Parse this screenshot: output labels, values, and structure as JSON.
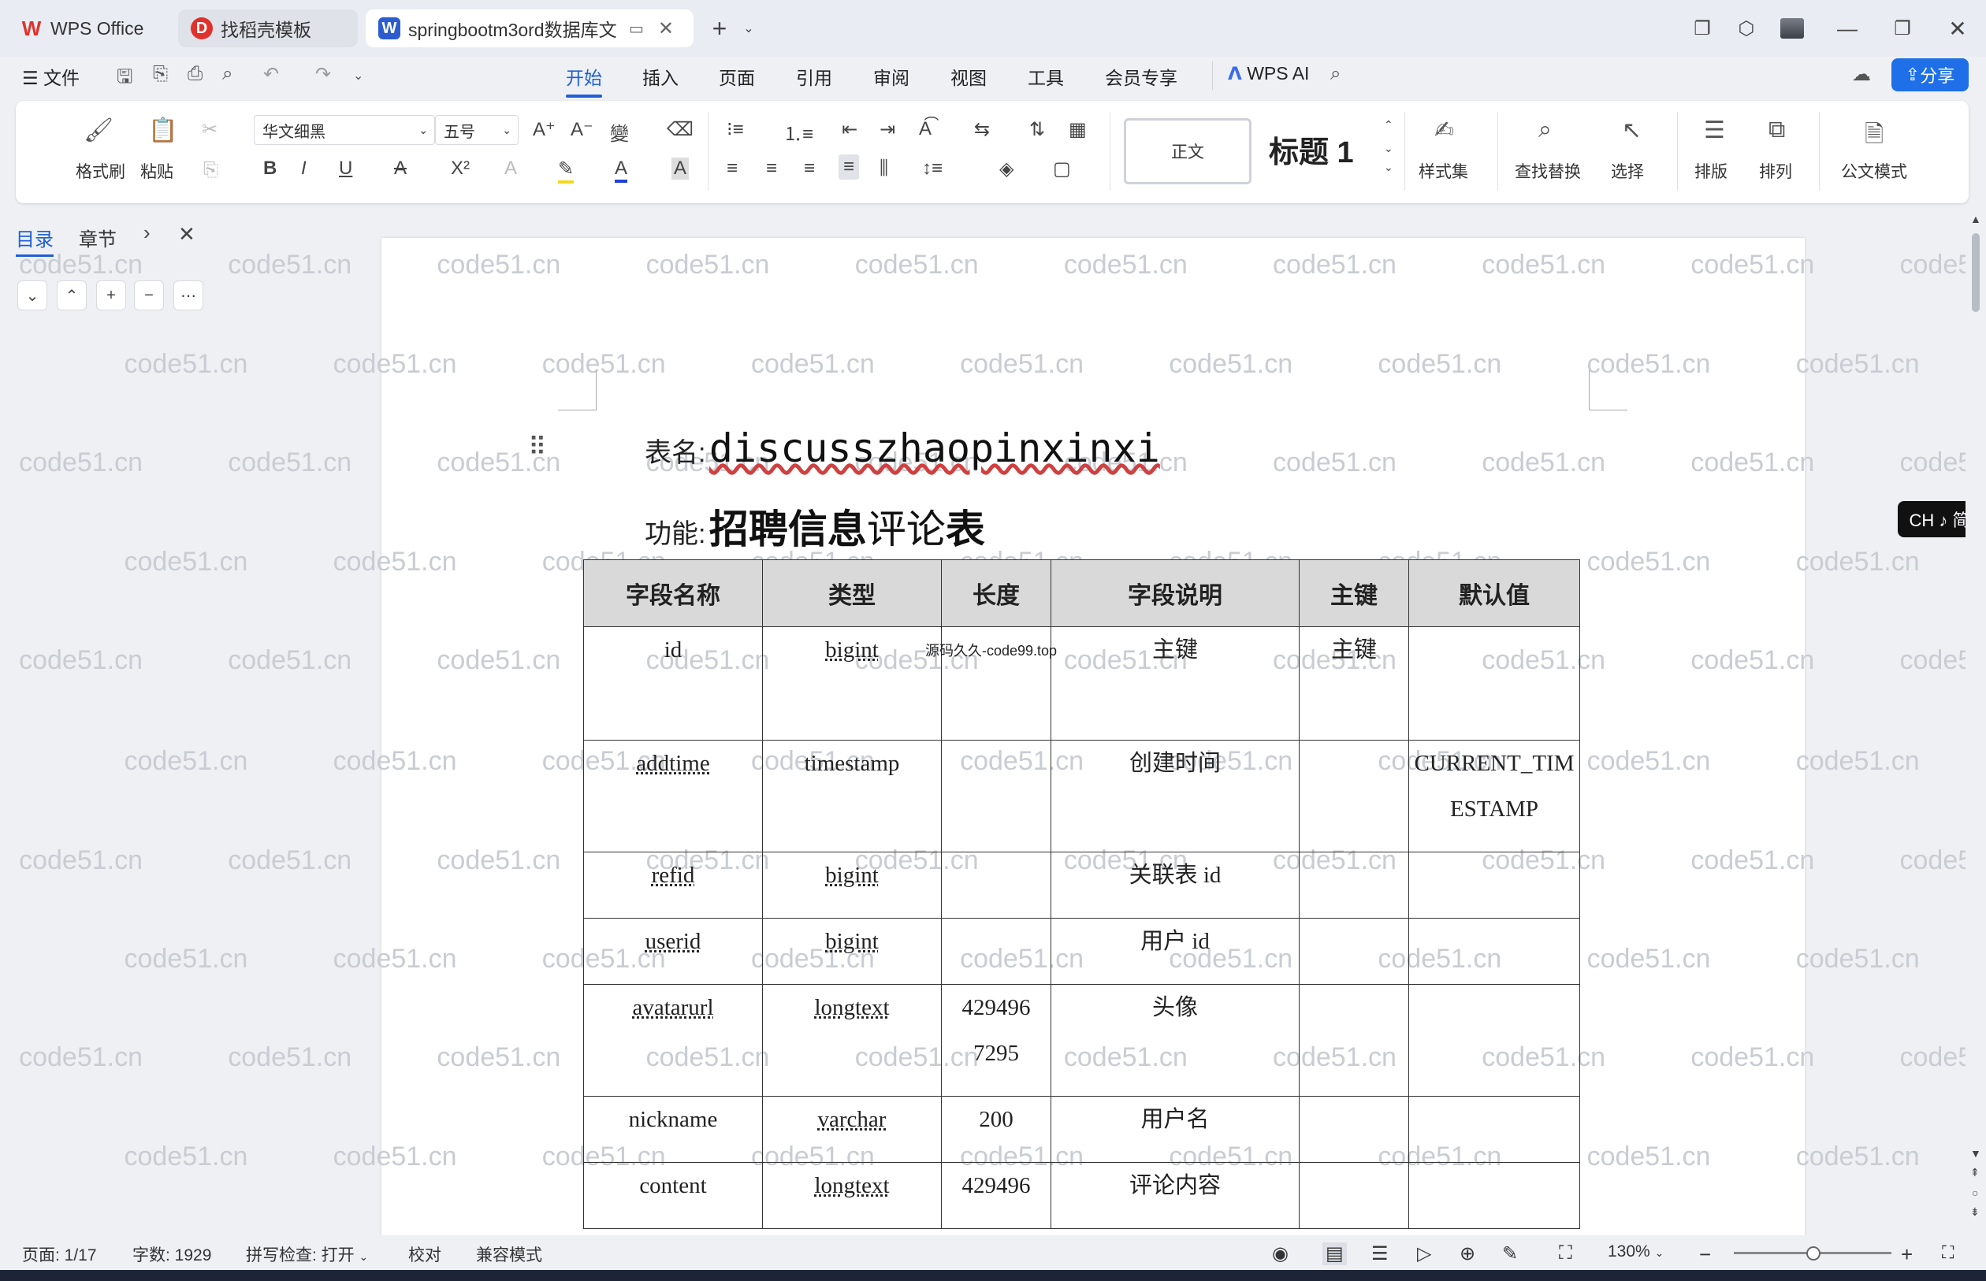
{
  "tabs": [
    {
      "label": "WPS Office",
      "icon": "wps-logo-icon"
    },
    {
      "label": "找稻壳模板",
      "icon": "docer-icon"
    },
    {
      "label": "springbootm3ord数据库文",
      "icon": "word-doc-icon"
    }
  ],
  "menu": {
    "file": "文件",
    "items": [
      "开始",
      "插入",
      "页面",
      "引用",
      "审阅",
      "视图",
      "工具",
      "会员专享"
    ],
    "active": "开始",
    "wps_ai": "WPS AI",
    "share": "分享"
  },
  "ribbon": {
    "format_painter": "格式刷",
    "paste": "粘贴",
    "font_name": "华文细黑",
    "font_size": "五号",
    "style_normal": "正文",
    "style_heading": "标题 1",
    "style_set": "样式集",
    "find_replace": "查找替换",
    "select": "选择",
    "layout": "排版",
    "arrange": "排列",
    "official_mode": "公文模式"
  },
  "nav_panel": {
    "toc_tab": "目录",
    "section_tab": "章节"
  },
  "document": {
    "table_name_label": "表名:",
    "table_name": "discusszhaopinxinxi",
    "function_label": "功能:",
    "function_bold": "招聘信息",
    "function_normal": "评论",
    "function_end": "表",
    "small_note": "源码久久-code99.top",
    "watermark": "code51.cn",
    "columns": [
      "字段名称",
      "类型",
      "长度",
      "字段说明",
      "主键",
      "默认值"
    ],
    "rows": [
      {
        "name": "id",
        "type": "bigint",
        "length": "",
        "desc": "主键",
        "pk": "主键",
        "default": ""
      },
      {
        "name": "addtime",
        "type": "timestamp",
        "length": "",
        "desc": "创建时间",
        "pk": "",
        "default": "CURRENT_TIM ESTAMP"
      },
      {
        "name": "refid",
        "type": "bigint",
        "length": "",
        "desc": "关联表 id",
        "pk": "",
        "default": ""
      },
      {
        "name": "userid",
        "type": "bigint",
        "length": "",
        "desc": "用户 id",
        "pk": "",
        "default": ""
      },
      {
        "name": "avatarurl",
        "type": "longtext",
        "length": "429496 7295",
        "desc": "头像",
        "pk": "",
        "default": ""
      },
      {
        "name": "nickname",
        "type": "varchar",
        "length": "200",
        "desc": "用户名",
        "pk": "",
        "default": ""
      },
      {
        "name": "content",
        "type": "longtext",
        "length": "429496",
        "desc": "评论内容",
        "pk": "",
        "default": ""
      }
    ]
  },
  "ime": "CH ♪ 简",
  "status": {
    "page": "页面: 1/17",
    "words": "字数: 1929",
    "spell": "拼写检查: 打开",
    "proof": "校对",
    "compat": "兼容模式",
    "zoom": "130%"
  },
  "colors": {
    "accent": "#1e5fd8",
    "wps_red": "#e0322c",
    "word_blue": "#2b5dd1"
  }
}
